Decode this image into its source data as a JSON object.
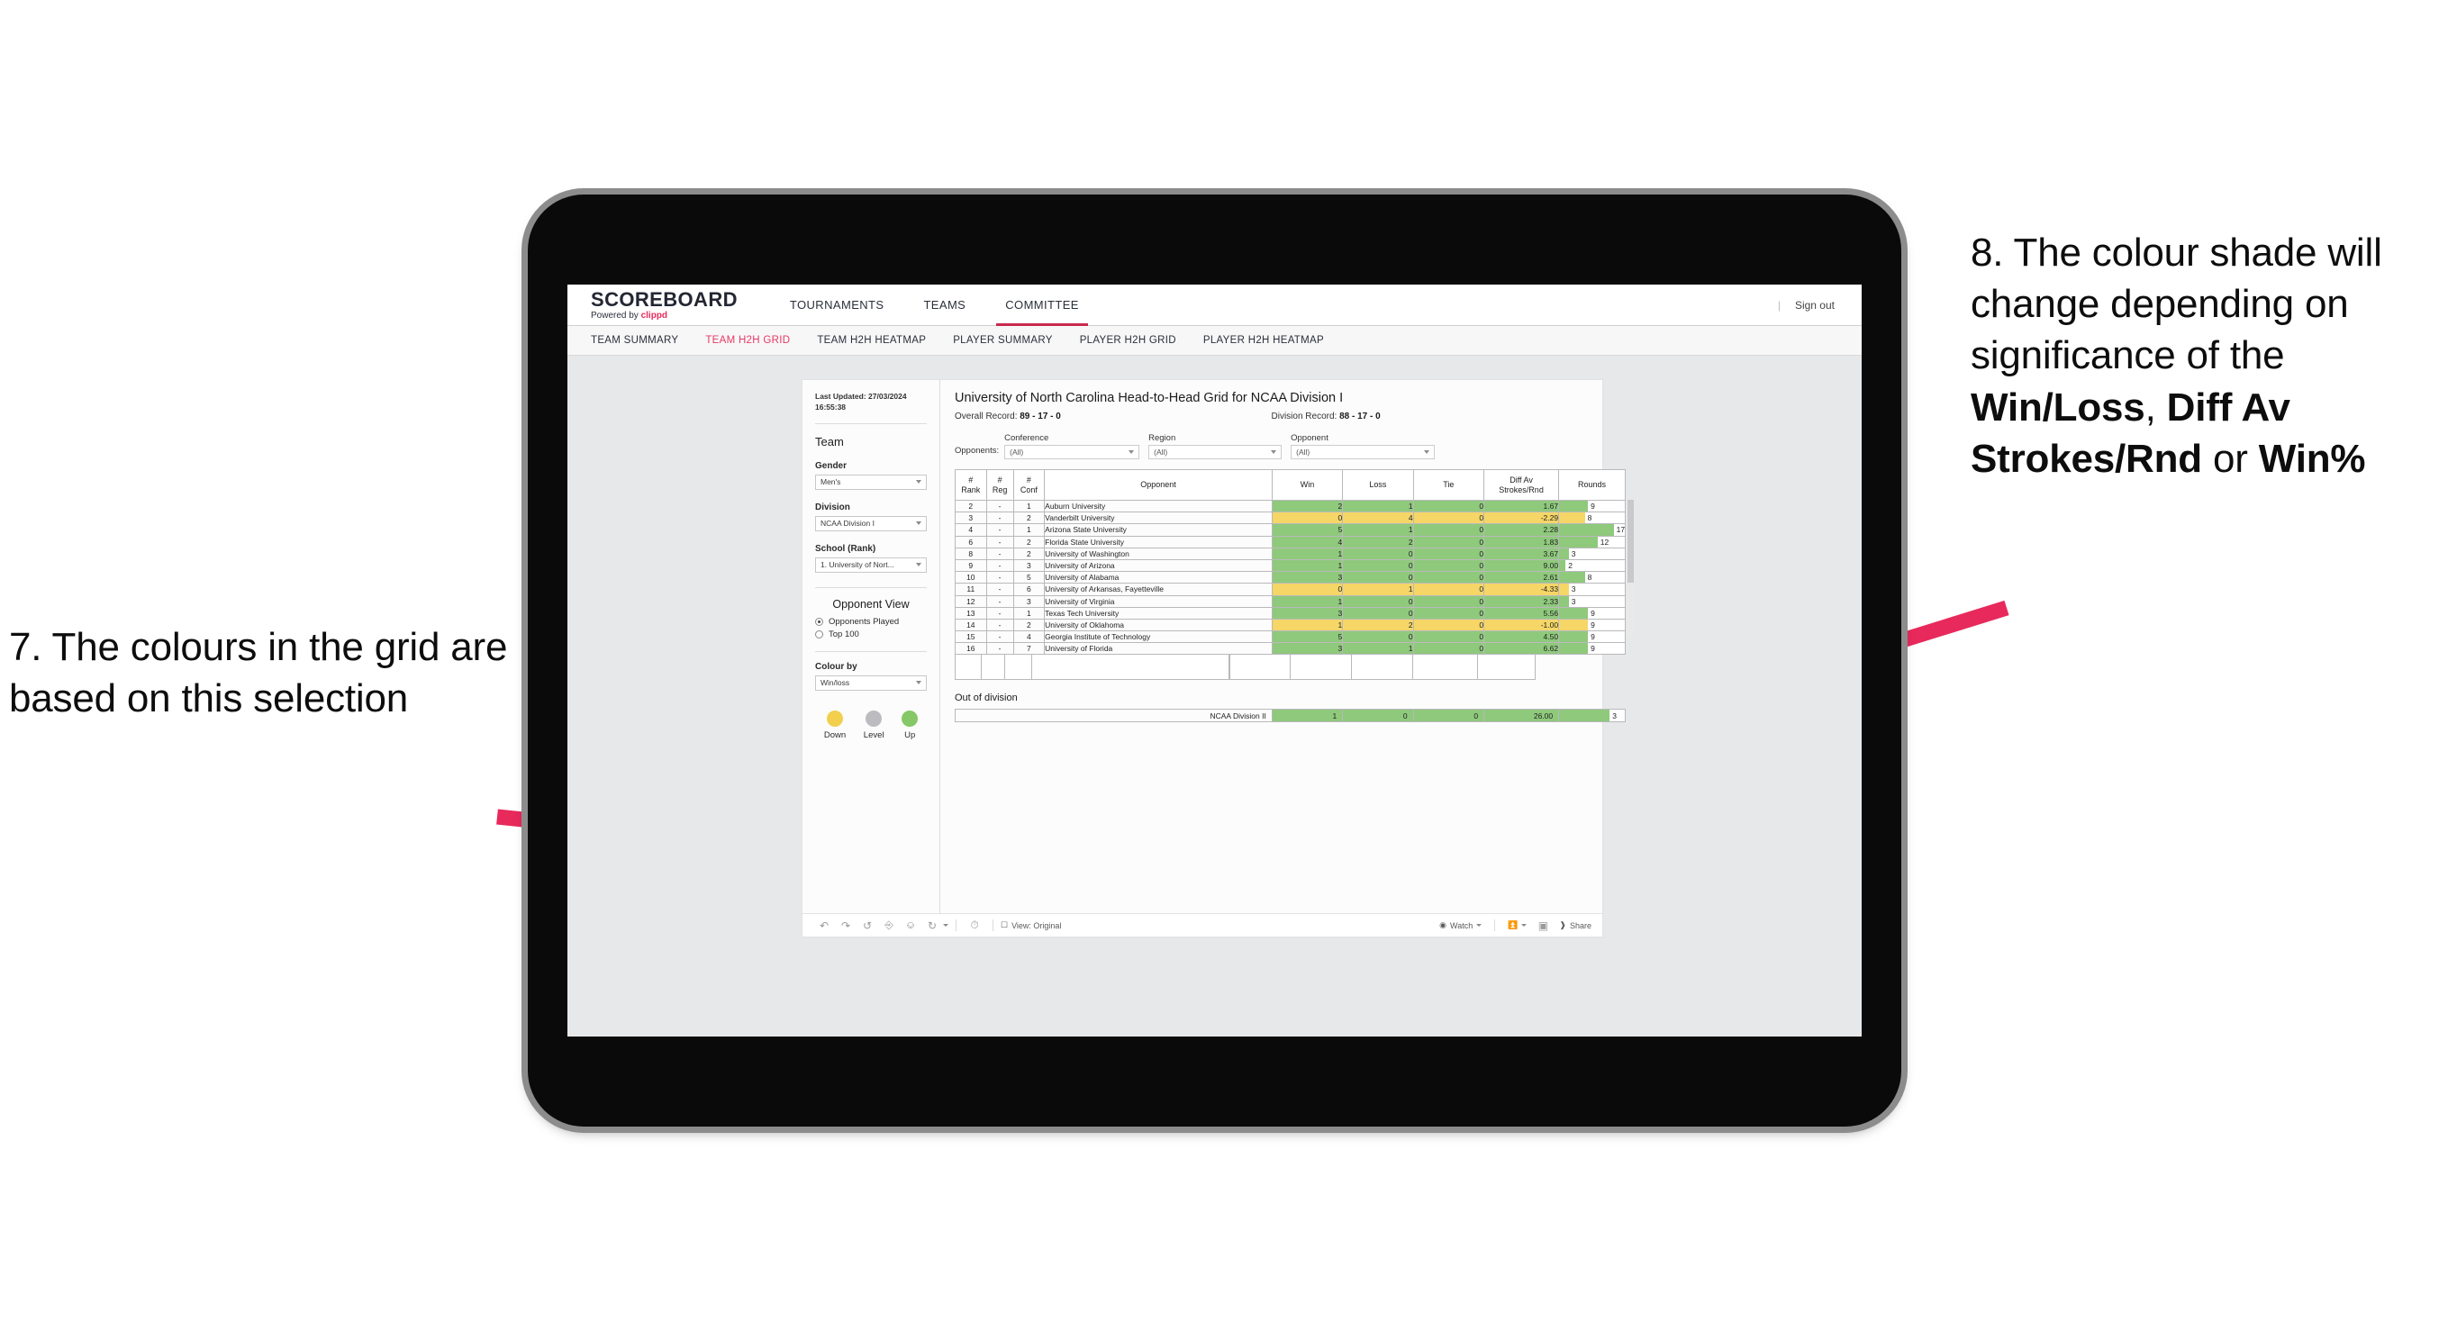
{
  "annotations": {
    "left": {
      "number": "7.",
      "text": "7. The colours in the grid are based on this selection"
    },
    "right": {
      "pre": "8. The colour shade will change depending on significance of the ",
      "bold1": "Win/Loss",
      "mid1": ", ",
      "bold2": "Diff Av Strokes/Rnd",
      "mid2": " or ",
      "bold3": "Win%"
    },
    "arrow_color": "#e8295b"
  },
  "app": {
    "brand": {
      "title": "SCOREBOARD",
      "powered_by": "Powered by",
      "vendor": "clippd"
    },
    "topnav": [
      {
        "label": "TOURNAMENTS",
        "active": false
      },
      {
        "label": "TEAMS",
        "active": false
      },
      {
        "label": "COMMITTEE",
        "active": true
      }
    ],
    "topbar_right": {
      "separator": "|",
      "sign_out": "Sign out"
    },
    "subnav": [
      {
        "label": "TEAM SUMMARY",
        "active": false
      },
      {
        "label": "TEAM H2H GRID",
        "active": true
      },
      {
        "label": "TEAM H2H HEATMAP",
        "active": false
      },
      {
        "label": "PLAYER SUMMARY",
        "active": false
      },
      {
        "label": "PLAYER H2H GRID",
        "active": false
      },
      {
        "label": "PLAYER H2H HEATMAP",
        "active": false
      }
    ],
    "accent_active": "#e83a63"
  },
  "sidebar": {
    "last_updated_label": "Last Updated:",
    "last_updated_value": "27/03/2024 16:55:38",
    "team_heading": "Team",
    "gender": {
      "label": "Gender",
      "value": "Men's"
    },
    "division": {
      "label": "Division",
      "value": "NCAA Division I"
    },
    "school": {
      "label": "School (Rank)",
      "value": "1. University of Nort..."
    },
    "opponent_view": {
      "heading": "Opponent View",
      "options": [
        {
          "label": "Opponents Played",
          "selected": true
        },
        {
          "label": "Top 100",
          "selected": false
        }
      ]
    },
    "colour_by": {
      "label": "Colour by",
      "value": "Win/loss"
    },
    "legend": [
      {
        "label": "Down",
        "color": "#f2d04e"
      },
      {
        "label": "Level",
        "color": "#bcbcc0"
      },
      {
        "label": "Up",
        "color": "#86c767"
      }
    ]
  },
  "viz": {
    "title": "University of North Carolina Head-to-Head Grid for NCAA Division I",
    "overall_record_label": "Overall Record:",
    "overall_record_value": "89 - 17 - 0",
    "division_record_label": "Division Record:",
    "division_record_value": "88 - 17 - 0",
    "filters": {
      "lead": "Opponents:",
      "items": [
        {
          "label": "Conference",
          "value": "(All)"
        },
        {
          "label": "Region",
          "value": "(All)"
        },
        {
          "label": "Opponent",
          "value": "(All)"
        }
      ]
    },
    "out_of_division_title": "Out of division",
    "out_of_division_row": {
      "label": "NCAA Division II",
      "win": "1",
      "loss": "0",
      "tie": "0",
      "diff": "26.00",
      "rounds": "3"
    }
  },
  "chart_data": {
    "type": "table",
    "title": "University of North Carolina Head-to-Head Grid for NCAA Division I",
    "columns": [
      "# Rank",
      "# Reg",
      "# Conf",
      "Opponent",
      "Win",
      "Loss",
      "Tie",
      "Diff Av Strokes/Rnd",
      "Rounds"
    ],
    "column_headers_multiline": [
      [
        "#",
        "Rank"
      ],
      [
        "#",
        "Reg"
      ],
      [
        "#",
        "Conf"
      ],
      [
        "",
        "Opponent"
      ],
      [
        "Win",
        ""
      ],
      [
        "Loss",
        ""
      ],
      [
        "Tie",
        ""
      ],
      [
        "Diff Av",
        "Strokes/Rnd"
      ],
      [
        "Rounds",
        ""
      ]
    ],
    "rounds_max": 17,
    "colors": {
      "up": "#8fc97c",
      "down": "#f5d667"
    },
    "rows": [
      {
        "rank": "2",
        "reg": "-",
        "conf": "1",
        "opponent": "Auburn University",
        "win": "2",
        "loss": "1",
        "tie": "0",
        "diff": "1.67",
        "rounds": 9,
        "state": "g"
      },
      {
        "rank": "3",
        "reg": "-",
        "conf": "2",
        "opponent": "Vanderbilt University",
        "win": "0",
        "loss": "4",
        "tie": "0",
        "diff": "-2.29",
        "rounds": 8,
        "state": "y"
      },
      {
        "rank": "4",
        "reg": "-",
        "conf": "1",
        "opponent": "Arizona State University",
        "win": "5",
        "loss": "1",
        "tie": "0",
        "diff": "2.28",
        "rounds": 17,
        "state": "g"
      },
      {
        "rank": "6",
        "reg": "-",
        "conf": "2",
        "opponent": "Florida State University",
        "win": "4",
        "loss": "2",
        "tie": "0",
        "diff": "1.83",
        "rounds": 12,
        "state": "g"
      },
      {
        "rank": "8",
        "reg": "-",
        "conf": "2",
        "opponent": "University of Washington",
        "win": "1",
        "loss": "0",
        "tie": "0",
        "diff": "3.67",
        "rounds": 3,
        "state": "g"
      },
      {
        "rank": "9",
        "reg": "-",
        "conf": "3",
        "opponent": "University of Arizona",
        "win": "1",
        "loss": "0",
        "tie": "0",
        "diff": "9.00",
        "rounds": 2,
        "state": "g"
      },
      {
        "rank": "10",
        "reg": "-",
        "conf": "5",
        "opponent": "University of Alabama",
        "win": "3",
        "loss": "0",
        "tie": "0",
        "diff": "2.61",
        "rounds": 8,
        "state": "g"
      },
      {
        "rank": "11",
        "reg": "-",
        "conf": "6",
        "opponent": "University of Arkansas, Fayetteville",
        "win": "0",
        "loss": "1",
        "tie": "0",
        "diff": "-4.33",
        "rounds": 3,
        "state": "y"
      },
      {
        "rank": "12",
        "reg": "-",
        "conf": "3",
        "opponent": "University of Virginia",
        "win": "1",
        "loss": "0",
        "tie": "0",
        "diff": "2.33",
        "rounds": 3,
        "state": "g"
      },
      {
        "rank": "13",
        "reg": "-",
        "conf": "1",
        "opponent": "Texas Tech University",
        "win": "3",
        "loss": "0",
        "tie": "0",
        "diff": "5.56",
        "rounds": 9,
        "state": "g"
      },
      {
        "rank": "14",
        "reg": "-",
        "conf": "2",
        "opponent": "University of Oklahoma",
        "win": "1",
        "loss": "2",
        "tie": "0",
        "diff": "-1.00",
        "rounds": 9,
        "state": "y"
      },
      {
        "rank": "15",
        "reg": "-",
        "conf": "4",
        "opponent": "Georgia Institute of Technology",
        "win": "5",
        "loss": "0",
        "tie": "0",
        "diff": "4.50",
        "rounds": 9,
        "state": "g"
      },
      {
        "rank": "16",
        "reg": "-",
        "conf": "7",
        "opponent": "University of Florida",
        "win": "3",
        "loss": "1",
        "tie": "0",
        "diff": "6.62",
        "rounds": 9,
        "state": "g"
      }
    ]
  },
  "toolbar": {
    "view_label": "View: Original",
    "watch_label": "Watch",
    "share_label": "Share"
  }
}
